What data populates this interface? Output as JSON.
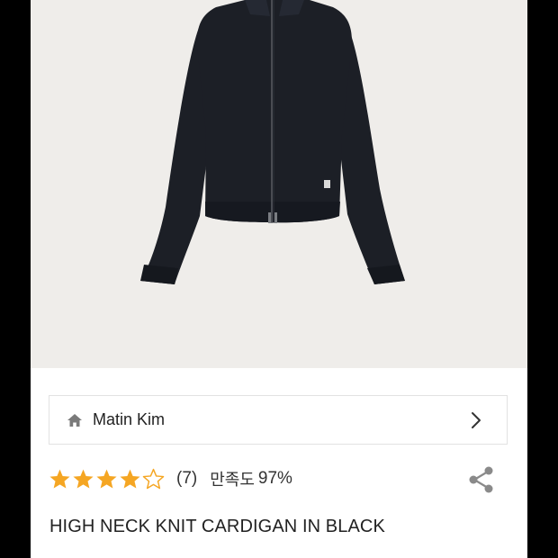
{
  "brand": {
    "name": "Matin Kim",
    "icon": "home-icon",
    "chevron_icon": "chevron-right-icon"
  },
  "rating": {
    "stars": 4,
    "max_stars": 5,
    "review_count": "(7)",
    "satisfaction_label": "만족도",
    "satisfaction_value": "97%",
    "star_color": "#f5a623"
  },
  "share": {
    "icon": "share-icon"
  },
  "product": {
    "title": "HIGH NECK KNIT CARDIGAN IN BLACK"
  },
  "colors": {
    "image_background": "#efedea",
    "garment": "#1c1f26",
    "frame_bars": "#000000"
  }
}
